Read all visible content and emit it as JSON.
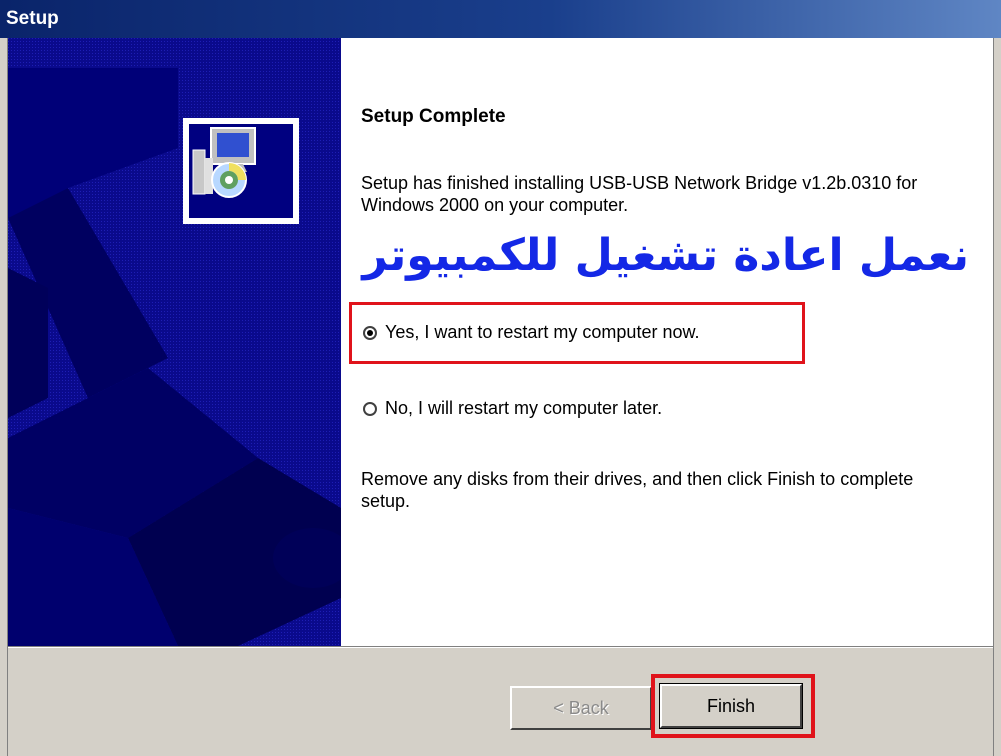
{
  "window": {
    "title": "Setup"
  },
  "content": {
    "heading": "Setup Complete",
    "description": "Setup has finished installing USB-USB Network Bridge v1.2b.0310 for Windows 2000 on your computer.",
    "arabic_note": "نعمل اعادة تشغيل للكمبيوتر",
    "options": {
      "yes_label": "Yes, I want to restart my computer now.",
      "no_label": "No, I will restart my computer later.",
      "selected": "yes"
    },
    "instructions": "Remove any disks from their drives, and then click Finish to complete setup."
  },
  "buttons": {
    "back_label": "< Back",
    "finish_label": "Finish"
  },
  "icons": {
    "setup": "setup-installer-icon"
  },
  "colors": {
    "title_bar": "#0a246a",
    "banner": "#0a0a8c",
    "highlight": "#e0131b",
    "arabic_text": "#1428e6"
  }
}
